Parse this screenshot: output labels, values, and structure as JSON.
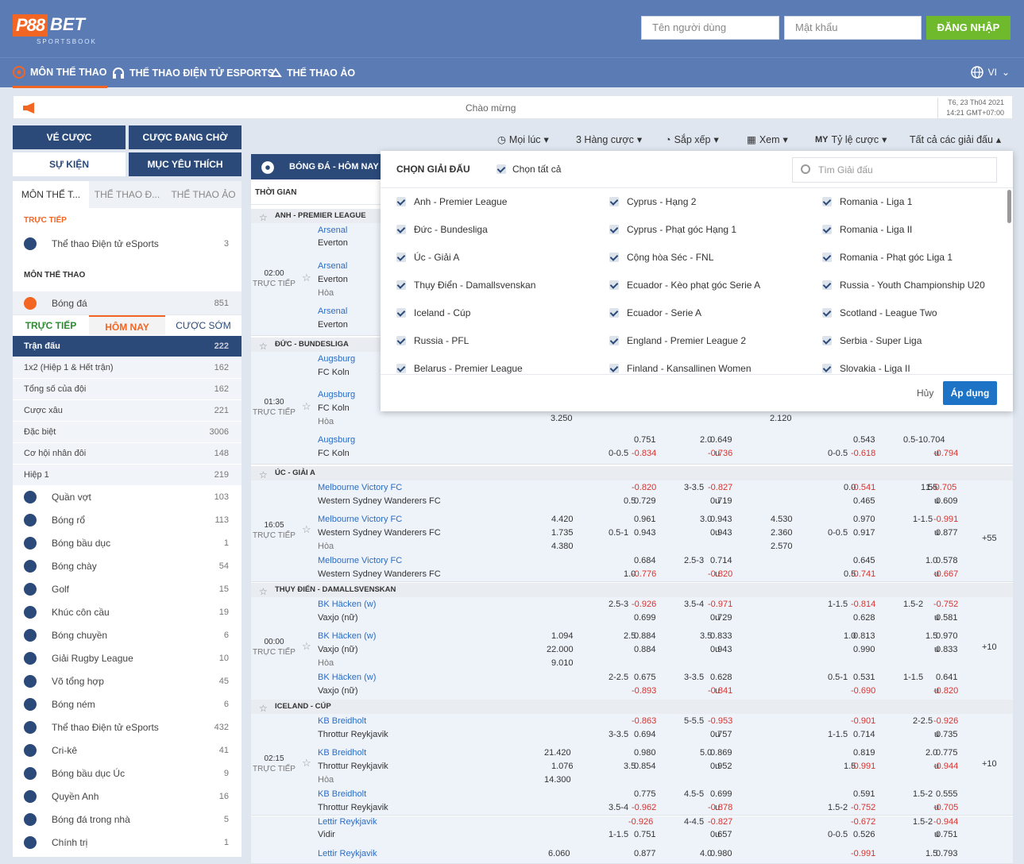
{
  "header": {
    "logo_p88": "P88",
    "logo_bet": "BET",
    "logo_sub": "SPORTSBOOK",
    "username_placeholder": "Tên người dùng",
    "password_placeholder": "Mật khẩu",
    "login_label": "ĐĂNG NHẬP",
    "lang": "VI"
  },
  "nav": [
    {
      "label": "MÔN THỂ THAO"
    },
    {
      "label": "THỂ THAO ĐIỆN TỬ ESPORTS"
    },
    {
      "label": "THỂ THAO ẢO"
    }
  ],
  "announce": {
    "text": "Chào mừng",
    "date": "T6, 23 Th04 2021",
    "time": "14:21 GMT+07:00"
  },
  "side_buttons": {
    "ve_cuoc": "VÉ CƯỢC",
    "cuoc_dang_cho": "CƯỢC ĐANG CHỜ",
    "su_kien": "SỰ KIỆN",
    "muc_yeu_thich": "MỤC YÊU THÍCH"
  },
  "left_tabs": [
    "MÔN THỂ T...",
    "THỂ THAO Đ...",
    "THỂ THAO ẢO"
  ],
  "live_label": "TRỰC TIẾP",
  "live_item": {
    "label": "Thể thao Điện tử eSports",
    "count": "3"
  },
  "sports_label": "MÔN THỂ THAO",
  "football": {
    "label": "Bóng đá",
    "count": "851"
  },
  "subtabs": [
    "TRỰC TIẾP",
    "HÔM NAY",
    "CƯỢC SỚM"
  ],
  "markets": [
    {
      "label": "Trận đấu",
      "count": "222"
    },
    {
      "label": "1x2 (Hiệp 1 & Hết trận)",
      "count": "162"
    },
    {
      "label": "Tổng số của đội",
      "count": "162"
    },
    {
      "label": "Cược xâu",
      "count": "221"
    },
    {
      "label": "Đặc biệt",
      "count": "3006"
    },
    {
      "label": "Cơ hội nhân đôi",
      "count": "148"
    },
    {
      "label": "Hiệp 1",
      "count": "219"
    }
  ],
  "sports": [
    {
      "label": "Quần vợt",
      "count": "103"
    },
    {
      "label": "Bóng rổ",
      "count": "113"
    },
    {
      "label": "Bóng bầu dục",
      "count": "1"
    },
    {
      "label": "Bóng chày",
      "count": "54"
    },
    {
      "label": "Golf",
      "count": "15"
    },
    {
      "label": "Khúc côn cầu",
      "count": "19"
    },
    {
      "label": "Bóng chuyền",
      "count": "6"
    },
    {
      "label": "Giải Rugby League",
      "count": "10"
    },
    {
      "label": "Võ tổng hợp",
      "count": "45"
    },
    {
      "label": "Bóng ném",
      "count": "6"
    },
    {
      "label": "Thể thao Điện tử eSports",
      "count": "432"
    },
    {
      "label": "Cri-kê",
      "count": "41"
    },
    {
      "label": "Bóng bầu dục Úc",
      "count": "9"
    },
    {
      "label": "Quyền Anh",
      "count": "16"
    },
    {
      "label": "Bóng đá trong nhà",
      "count": "5"
    },
    {
      "label": "Chính trị",
      "count": "1"
    }
  ],
  "filters": {
    "moi_luc": "Mọi lúc",
    "hang_cuoc": "3 Hàng cược",
    "sap_xep": "Sắp xếp",
    "xem": "Xem",
    "my": "MY",
    "ty_le": "Tỷ lệ cược",
    "tat_ca": "Tất cả các giải đấu"
  },
  "main": {
    "title": "BÓNG ĐÁ - HÔM NAY T",
    "col_time": "THỜI GIAN"
  },
  "popup": {
    "title": "CHỌN GIẢI ĐẤU",
    "select_all": "Chọn tất cả",
    "search_placeholder": "Tìm Giải đấu",
    "cancel": "Hủy",
    "apply": "Áp dụng",
    "col1": [
      "Anh - Premier League",
      "Đức - Bundesliga",
      "Úc - Giải A",
      "Thụy Điển - Damallsvenskan",
      "Iceland - Cúp",
      "Russia - PFL",
      "Belarus - Premier League"
    ],
    "col2": [
      "Cyprus - Hạng 2",
      "Cyprus - Phạt góc Hạng 1",
      "Cộng hòa Séc - FNL",
      "Ecuador - Kèo phạt góc Serie A",
      "Ecuador - Serie A",
      "England - Premier League 2",
      "Finland - Kansallinen Women"
    ],
    "col3": [
      "Romania - Liga 1",
      "Romania - Liga II",
      "Romania - Phạt góc Liga 1",
      "Russia - Youth Championship U20",
      "Scotland - League Two",
      "Serbia - Super Liga",
      "Slovakia - Liga II"
    ]
  },
  "leagues": {
    "anh": "ANH - PREMIER LEAGUE",
    "duc": "ĐỨC - BUNDESLIGA",
    "uc": "ÚC - GIẢI A",
    "thuy": "THỤY ĐIỂN - DAMALLSVENSKAN",
    "iceland": "ICELAND - CÚP"
  },
  "matches": {
    "m1": {
      "time": "02:00",
      "live": "TRỰC TIẾP",
      "home": "Arsenal",
      "away": "Everton",
      "draw": "Hòa"
    },
    "m2": {
      "time": "01:30",
      "live": "TRỰC TIẾP",
      "home": "Augsburg",
      "away": "FC Koln",
      "draw": "Hòa"
    },
    "m3": {
      "time": "16:05",
      "live": "TRỰC TIẾP",
      "home": "Melbourne Victory FC",
      "away": "Western Sydney Wanderers FC",
      "draw": "Hòa",
      "plus": "+55"
    },
    "m4": {
      "time": "00:00",
      "live": "TRỰC TIẾP",
      "home": "BK Häcken (w)",
      "away": "Vaxjo (nữ)",
      "draw": "Hòa",
      "plus": "+10"
    },
    "m5": {
      "time": "02:15",
      "live": "TRỰC TIẾP",
      "home": "KB Breidholt",
      "away": "Throttur Reykjavik",
      "draw": "Hòa",
      "plus": "+10"
    },
    "m6": {
      "home": "Lettir Reykjavik",
      "away": "Vidir"
    }
  },
  "odds": {
    "aug_a": [
      "3.250",
      "2.120"
    ],
    "aug_b": [
      "0.751",
      "2.0",
      "0.649",
      "0.543",
      "0.5-1",
      "0.704",
      "0-0.5",
      "-0.834",
      "u",
      "-0.736",
      "0-0.5",
      "-0.618",
      "u",
      "-0.794"
    ],
    "mel_1": [
      "-0.820",
      "3-3.5",
      "-0.827",
      "0.0",
      "-0.541",
      "1.5",
      "-0.705",
      "0.5",
      "0.729",
      "u",
      "0.719",
      "0.465",
      "u",
      "0.609"
    ],
    "mel_2": [
      "4.420",
      "1.735",
      "4.380",
      "0.961",
      "3.0",
      "0.943",
      "4.530",
      "2.360",
      "2.570",
      "0.970",
      "1-1.5",
      "-0.991",
      "0.5-1",
      "0.943",
      "u",
      "0.943",
      "0-0.5",
      "0.917",
      "u",
      "0.877"
    ],
    "mel_3": [
      "0.684",
      "2.5-3",
      "0.714",
      "0.645",
      "1.0",
      "0.578",
      "1.0",
      "-0.776",
      "u",
      "-0.820",
      "0.5",
      "-0.741",
      "u",
      "-0.667"
    ],
    "bk_1": [
      "2.5-3",
      "-0.926",
      "3.5-4",
      "-0.971",
      "1-1.5",
      "-0.814",
      "1.5-2",
      "-0.752",
      "0.699",
      "u",
      "0.729",
      "0.628",
      "u",
      "0.581"
    ],
    "bk_2": [
      "1.094",
      "22.000",
      "9.010",
      "2.5",
      "0.884",
      "3.5",
      "0.833",
      "1.0",
      "0.813",
      "1.5",
      "0.970",
      "0.884",
      "u",
      "0.943",
      "0.990",
      "u",
      "0.833"
    ],
    "bk_3": [
      "2-2.5",
      "0.675",
      "3-3.5",
      "0.628",
      "0.5-1",
      "0.531",
      "1-1.5",
      "0.641",
      "-0.893",
      "u",
      "-0.841",
      "-0.690",
      "u",
      "-0.820"
    ],
    "kb_1": [
      "-0.863",
      "5-5.5",
      "-0.953",
      "-0.901",
      "2-2.5",
      "-0.926",
      "3-3.5",
      "0.694",
      "u",
      "0.757",
      "1-1.5",
      "0.714",
      "u",
      "0.735"
    ],
    "kb_2": [
      "21.420",
      "1.076",
      "14.300",
      "0.980",
      "5.0",
      "0.869",
      "0.819",
      "2.0",
      "0.775",
      "3.5",
      "0.854",
      "u",
      "0.952",
      "1.5",
      "-0.991",
      "u",
      "-0.944"
    ],
    "kb_3": [
      "0.775",
      "4.5-5",
      "0.699",
      "0.591",
      "1.5-2",
      "0.555",
      "3.5-4",
      "-0.962",
      "u",
      "-0.878",
      "1.5-2",
      "-0.752",
      "u",
      "-0.705"
    ],
    "le_1": [
      "-0.926",
      "4-4.5",
      "-0.827",
      "-0.672",
      "1.5-2",
      "-0.944",
      "1-1.5",
      "0.751",
      "u",
      "0.657",
      "0-0.5",
      "0.526",
      "u",
      "0.751"
    ],
    "le_2": [
      "6.060",
      "0.877",
      "4.0",
      "0.980",
      "-0.991",
      "1.5",
      "0.793"
    ]
  }
}
